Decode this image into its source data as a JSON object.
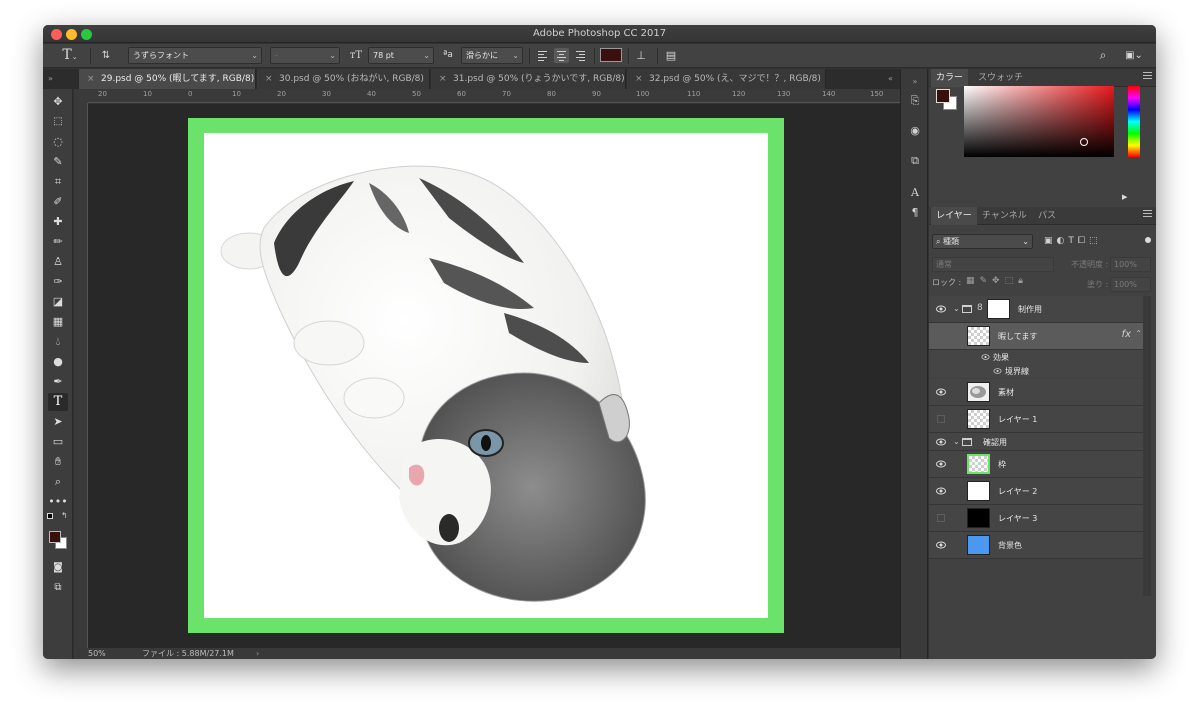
{
  "window": {
    "title": "Adobe Photoshop CC 2017"
  },
  "options_bar": {
    "tool_icon": "type-icon",
    "font_family": "うずらフォント",
    "font_style": "-",
    "font_size": "78 pt",
    "antialias": "滑らかに",
    "text_color": "#3a0f0d"
  },
  "tabs": [
    {
      "label": "29.psd @ 50% (暇してます, RGB/8) *",
      "active": true
    },
    {
      "label": "30.psd @ 50% (おねがい, RGB/8)",
      "active": false
    },
    {
      "label": "31.psd @ 50% (りょうかいです, RGB/8)",
      "active": false
    },
    {
      "label": "32.psd @ 50% (え、マジで！？, RGB/8)",
      "active": false
    }
  ],
  "ruler_ticks": [
    "20",
    "10",
    "0",
    "10",
    "20",
    "30",
    "40",
    "50",
    "60",
    "70",
    "80",
    "90",
    "100",
    "110",
    "120",
    "130",
    "140",
    "150"
  ],
  "tools": [
    "move-tool-icon",
    "marquee-tool-icon",
    "lasso-tool-icon",
    "quick-select-tool-icon",
    "crop-tool-icon",
    "eyedropper-tool-icon",
    "healing-brush-tool-icon",
    "brush-tool-icon",
    "clone-stamp-tool-icon",
    "history-brush-tool-icon",
    "eraser-tool-icon",
    "gradient-tool-icon",
    "blur-tool-icon",
    "dodge-tool-icon",
    "pen-tool-icon",
    "type-tool-icon",
    "path-select-tool-icon",
    "rectangle-tool-icon",
    "hand-tool-icon",
    "zoom-tool-icon",
    "more-tools-icon"
  ],
  "colors": {
    "foreground": "#3a0f0d",
    "background": "#ffffff",
    "frame_green": "#6be36b",
    "accent_blue": "#4a98ef"
  },
  "status": {
    "zoom": "50%",
    "file": "ファイル : 5.88M/27.1M",
    "arrow": "›"
  },
  "color_panel": {
    "tab_color": "カラー",
    "tab_swatch": "スウォッチ"
  },
  "layers_panel": {
    "tab_layers": "レイヤー",
    "tab_channels": "チャンネル",
    "tab_paths": "パス",
    "filter": "種類",
    "blend_mode": "通常",
    "opacity_label": "不透明度 :",
    "opacity_value": "100%",
    "lock_label": "ロック :",
    "fill_label": "塗り :",
    "fill_value": "100%",
    "layers": [
      {
        "name": "制作用",
        "type": "group",
        "visible": true
      },
      {
        "name": "暇してます",
        "type": "text",
        "visible": false,
        "selected": true,
        "fx": "fx"
      },
      {
        "name": "効果",
        "type": "effect"
      },
      {
        "name": "境界線",
        "type": "effect"
      },
      {
        "name": "素材",
        "type": "image",
        "visible": true
      },
      {
        "name": "レイヤー 1",
        "type": "image",
        "visible": false
      },
      {
        "name": "確認用",
        "type": "group",
        "visible": true
      },
      {
        "name": "枠",
        "type": "image",
        "visible": true
      },
      {
        "name": "レイヤー 2",
        "type": "image",
        "visible": true
      },
      {
        "name": "レイヤー 3",
        "type": "image",
        "visible": false
      },
      {
        "name": "背景色",
        "type": "image",
        "visible": true
      }
    ]
  }
}
